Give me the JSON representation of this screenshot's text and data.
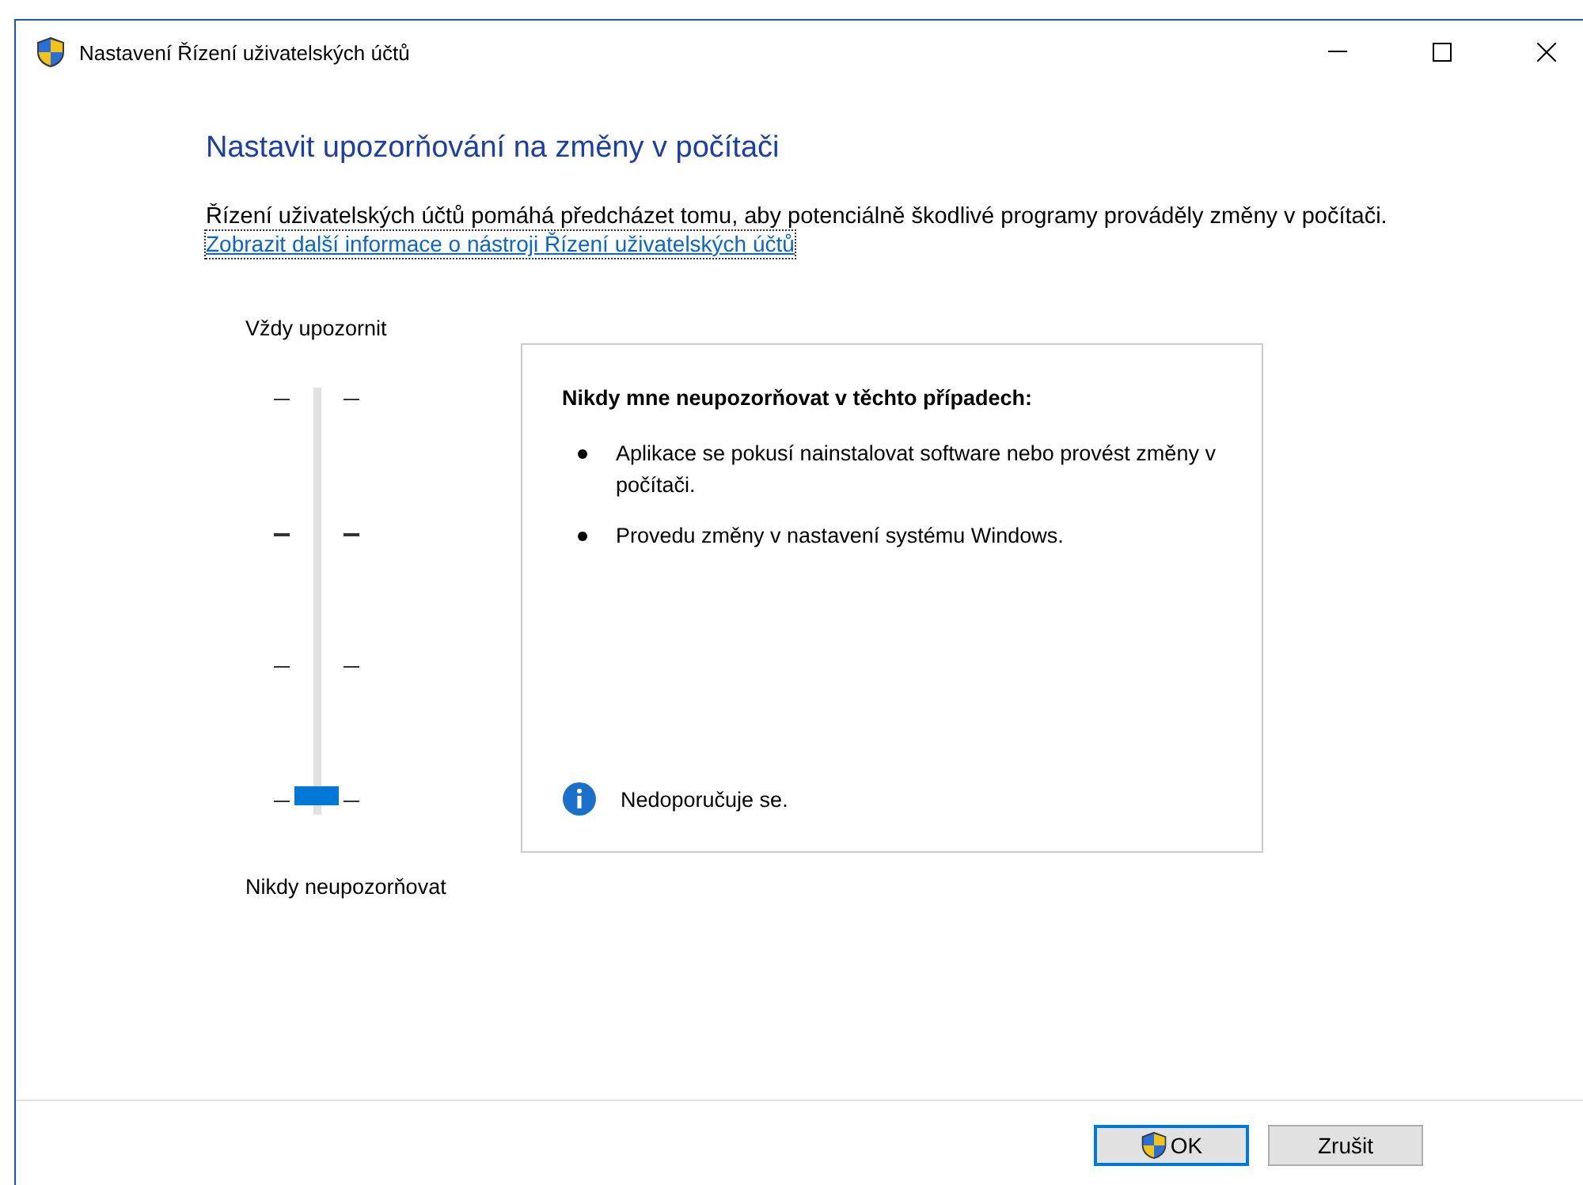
{
  "window": {
    "title": "Nastavení Řízení uživatelských účtů"
  },
  "heading": "Nastavit upozorňování na změny v počítači",
  "description": "Řízení uživatelských účtů pomáhá předcházet tomu, aby potenciálně škodlivé programy prováděly změny v počítači.",
  "link": "Zobrazit další informace o nástroji Řízení uživatelských účtů",
  "slider": {
    "top_label": "Vždy upozornit",
    "bottom_label": "Nikdy neupozorňovat",
    "level": 0
  },
  "panel": {
    "title": "Nikdy mne neupozorňovat v těchto případech:",
    "bullets": [
      "Aplikace se pokusí nainstalovat software nebo provést změny v počítači.",
      "Provedu změny v nastavení systému Windows."
    ],
    "note": "Nedoporučuje se."
  },
  "buttons": [
    {
      "label": "OK",
      "shield": true,
      "default": true
    },
    {
      "label": "Zrušit",
      "shield": false,
      "default": false
    }
  ]
}
